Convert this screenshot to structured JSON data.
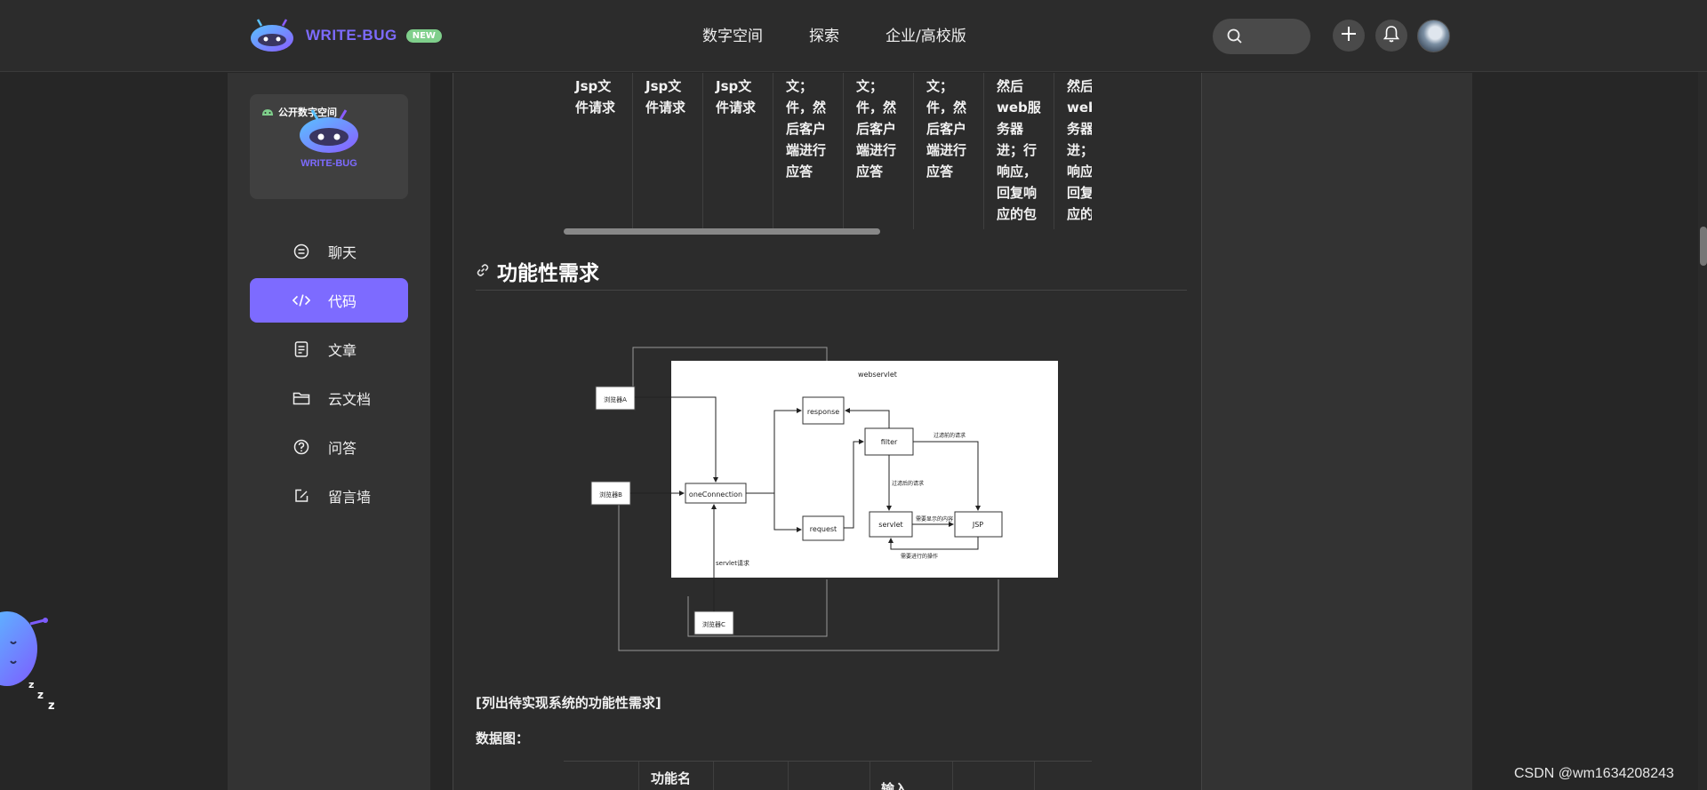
{
  "brand": {
    "name": "WRITE-BUG",
    "badge": "NEW"
  },
  "nav": {
    "items": [
      "数字空间",
      "探索",
      "企业/高校版"
    ]
  },
  "sidebar": {
    "space_label": "公开数字空间",
    "space_brand": "WRITE-BUG",
    "items": [
      {
        "label": "聊天",
        "icon": "chat-icon"
      },
      {
        "label": "代码",
        "icon": "code-icon",
        "active": true
      },
      {
        "label": "文章",
        "icon": "document-icon"
      },
      {
        "label": "云文档",
        "icon": "folder-icon"
      },
      {
        "label": "问答",
        "icon": "question-icon"
      },
      {
        "label": "留言墙",
        "icon": "edit-icon"
      }
    ]
  },
  "table_top": {
    "columns": [
      "Jsp文\n件请求",
      "Jsp文\n件请求",
      "Jsp文\n件请求",
      "文；\n件，然\n后客户\n端进行\n应答",
      "文；\n件，然\n后客户\n端进行\n应答",
      "文；\n件，然\n后客户\n端进行\n应答",
      "然后\nweb服\n务器\n进；行\n响应，\n回复响\n应的包",
      "然后\nweb\n务器\n进；\n响应\n回复\n应的"
    ]
  },
  "section": {
    "title": "功能性需求"
  },
  "diagram": {
    "nodes": {
      "browser_a": "浏览器A",
      "browser_b": "浏览器B",
      "browser_c": "浏览器C",
      "one_connection": "oneConnection",
      "response": "response",
      "request": "request",
      "filter": "filter",
      "servlet": "servlet",
      "jsp": "JSP",
      "webservlet": "webservlet"
    },
    "edge_labels": {
      "servlet_request": "servlet请求",
      "filter_request": "过滤后的请求",
      "filter_in": "过滤前的请求",
      "jsp_response": "需要显示的内容",
      "servlet_op": "需要进行的操作"
    }
  },
  "paragraphs": {
    "list_note": "[列出待实现系统的功能性需求]",
    "data_diagram": "数据图："
  },
  "table_bottom": {
    "headers": [
      "",
      "功能名",
      "",
      "",
      "输入",
      "",
      ""
    ]
  },
  "watermark": "CSDN @wm1634208243"
}
